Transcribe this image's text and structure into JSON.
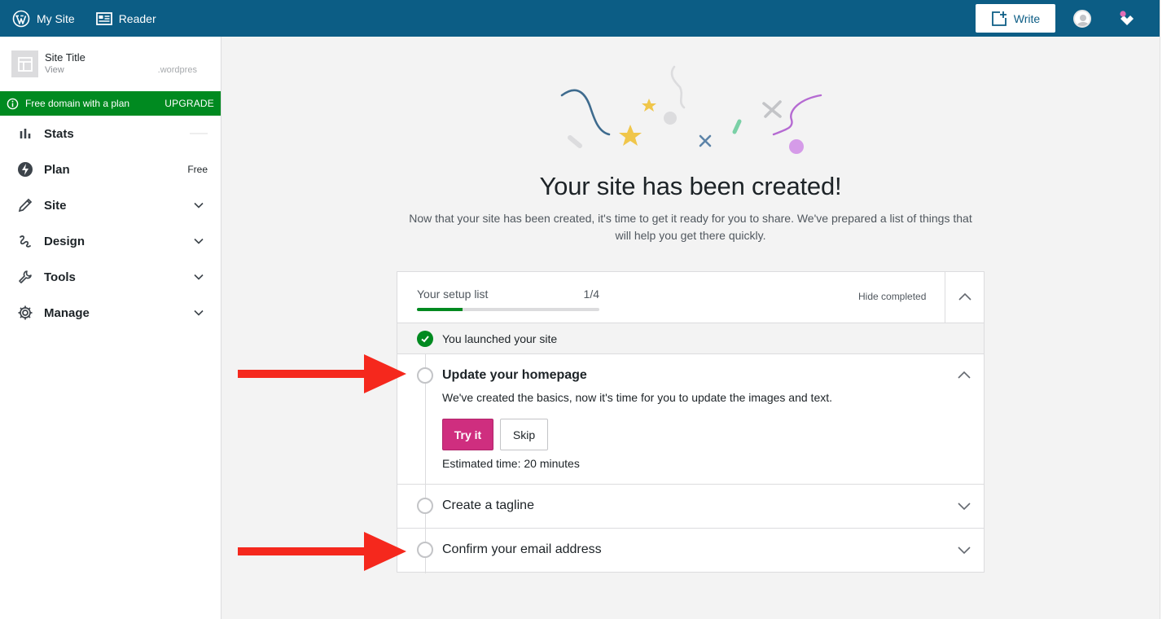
{
  "masterbar": {
    "my_site_label": "My Site",
    "reader_label": "Reader",
    "write_label": "Write",
    "icons": {
      "my_site": "wordpress-logo-icon",
      "reader": "reader-icon",
      "write": "write-icon",
      "avatar": "user-avatar-icon",
      "notifications": "notifications-icon"
    }
  },
  "sidebar": {
    "site": {
      "title": "Site Title",
      "view_label": "View",
      "url": ".wordpres"
    },
    "domain_banner": {
      "text": "Free domain with a plan",
      "action": "UPGRADE"
    },
    "items": [
      {
        "label": "Stats",
        "icon": "stats-icon"
      },
      {
        "label": "Plan",
        "icon": "plan-icon",
        "badge": "Free"
      },
      {
        "label": "Site",
        "icon": "pencil-icon"
      },
      {
        "label": "Design",
        "icon": "design-icon"
      },
      {
        "label": "Tools",
        "icon": "wrench-icon"
      },
      {
        "label": "Manage",
        "icon": "gear-icon"
      }
    ]
  },
  "main": {
    "headline": "Your site has been created!",
    "subline": "Now that your site has been created, it's time to get it ready for you to share. We've prepared a list of things that will help you get there quickly.",
    "setup": {
      "title": "Your setup list",
      "progress_text": "1/4",
      "progress_fraction": 0.25,
      "hide_completed": "Hide completed",
      "completed_task": "You launched your site",
      "tasks": [
        {
          "title": "Update your homepage",
          "description": "We've created the basics, now it's time for you to update the images and text.",
          "primary": "Try it",
          "secondary": "Skip",
          "estimate": "Estimated time: 20 minutes"
        },
        {
          "title": "Create a tagline"
        },
        {
          "title": "Confirm your email address"
        }
      ]
    }
  },
  "colors": {
    "masterbar": "#0c5d85",
    "success": "#008a20",
    "primary_button": "#cf2e7f",
    "annotation_arrow": "#f5281d"
  }
}
